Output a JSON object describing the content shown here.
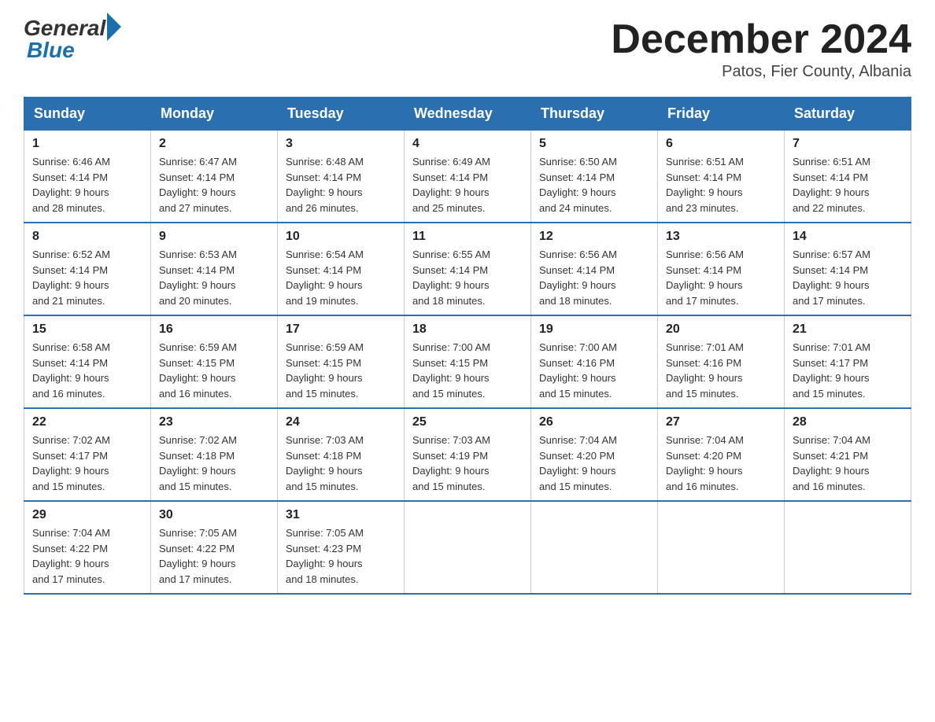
{
  "logo": {
    "general": "General",
    "blue": "Blue"
  },
  "title": "December 2024",
  "location": "Patos, Fier County, Albania",
  "days_of_week": [
    "Sunday",
    "Monday",
    "Tuesday",
    "Wednesday",
    "Thursday",
    "Friday",
    "Saturday"
  ],
  "weeks": [
    [
      {
        "day": "1",
        "sunrise": "6:46 AM",
        "sunset": "4:14 PM",
        "daylight": "9 hours and 28 minutes."
      },
      {
        "day": "2",
        "sunrise": "6:47 AM",
        "sunset": "4:14 PM",
        "daylight": "9 hours and 27 minutes."
      },
      {
        "day": "3",
        "sunrise": "6:48 AM",
        "sunset": "4:14 PM",
        "daylight": "9 hours and 26 minutes."
      },
      {
        "day": "4",
        "sunrise": "6:49 AM",
        "sunset": "4:14 PM",
        "daylight": "9 hours and 25 minutes."
      },
      {
        "day": "5",
        "sunrise": "6:50 AM",
        "sunset": "4:14 PM",
        "daylight": "9 hours and 24 minutes."
      },
      {
        "day": "6",
        "sunrise": "6:51 AM",
        "sunset": "4:14 PM",
        "daylight": "9 hours and 23 minutes."
      },
      {
        "day": "7",
        "sunrise": "6:51 AM",
        "sunset": "4:14 PM",
        "daylight": "9 hours and 22 minutes."
      }
    ],
    [
      {
        "day": "8",
        "sunrise": "6:52 AM",
        "sunset": "4:14 PM",
        "daylight": "9 hours and 21 minutes."
      },
      {
        "day": "9",
        "sunrise": "6:53 AM",
        "sunset": "4:14 PM",
        "daylight": "9 hours and 20 minutes."
      },
      {
        "day": "10",
        "sunrise": "6:54 AM",
        "sunset": "4:14 PM",
        "daylight": "9 hours and 19 minutes."
      },
      {
        "day": "11",
        "sunrise": "6:55 AM",
        "sunset": "4:14 PM",
        "daylight": "9 hours and 18 minutes."
      },
      {
        "day": "12",
        "sunrise": "6:56 AM",
        "sunset": "4:14 PM",
        "daylight": "9 hours and 18 minutes."
      },
      {
        "day": "13",
        "sunrise": "6:56 AM",
        "sunset": "4:14 PM",
        "daylight": "9 hours and 17 minutes."
      },
      {
        "day": "14",
        "sunrise": "6:57 AM",
        "sunset": "4:14 PM",
        "daylight": "9 hours and 17 minutes."
      }
    ],
    [
      {
        "day": "15",
        "sunrise": "6:58 AM",
        "sunset": "4:14 PM",
        "daylight": "9 hours and 16 minutes."
      },
      {
        "day": "16",
        "sunrise": "6:59 AM",
        "sunset": "4:15 PM",
        "daylight": "9 hours and 16 minutes."
      },
      {
        "day": "17",
        "sunrise": "6:59 AM",
        "sunset": "4:15 PM",
        "daylight": "9 hours and 15 minutes."
      },
      {
        "day": "18",
        "sunrise": "7:00 AM",
        "sunset": "4:15 PM",
        "daylight": "9 hours and 15 minutes."
      },
      {
        "day": "19",
        "sunrise": "7:00 AM",
        "sunset": "4:16 PM",
        "daylight": "9 hours and 15 minutes."
      },
      {
        "day": "20",
        "sunrise": "7:01 AM",
        "sunset": "4:16 PM",
        "daylight": "9 hours and 15 minutes."
      },
      {
        "day": "21",
        "sunrise": "7:01 AM",
        "sunset": "4:17 PM",
        "daylight": "9 hours and 15 minutes."
      }
    ],
    [
      {
        "day": "22",
        "sunrise": "7:02 AM",
        "sunset": "4:17 PM",
        "daylight": "9 hours and 15 minutes."
      },
      {
        "day": "23",
        "sunrise": "7:02 AM",
        "sunset": "4:18 PM",
        "daylight": "9 hours and 15 minutes."
      },
      {
        "day": "24",
        "sunrise": "7:03 AM",
        "sunset": "4:18 PM",
        "daylight": "9 hours and 15 minutes."
      },
      {
        "day": "25",
        "sunrise": "7:03 AM",
        "sunset": "4:19 PM",
        "daylight": "9 hours and 15 minutes."
      },
      {
        "day": "26",
        "sunrise": "7:04 AM",
        "sunset": "4:20 PM",
        "daylight": "9 hours and 15 minutes."
      },
      {
        "day": "27",
        "sunrise": "7:04 AM",
        "sunset": "4:20 PM",
        "daylight": "9 hours and 16 minutes."
      },
      {
        "day": "28",
        "sunrise": "7:04 AM",
        "sunset": "4:21 PM",
        "daylight": "9 hours and 16 minutes."
      }
    ],
    [
      {
        "day": "29",
        "sunrise": "7:04 AM",
        "sunset": "4:22 PM",
        "daylight": "9 hours and 17 minutes."
      },
      {
        "day": "30",
        "sunrise": "7:05 AM",
        "sunset": "4:22 PM",
        "daylight": "9 hours and 17 minutes."
      },
      {
        "day": "31",
        "sunrise": "7:05 AM",
        "sunset": "4:23 PM",
        "daylight": "9 hours and 18 minutes."
      },
      null,
      null,
      null,
      null
    ]
  ],
  "labels": {
    "sunrise_prefix": "Sunrise: ",
    "sunset_prefix": "Sunset: ",
    "daylight_prefix": "Daylight: "
  }
}
